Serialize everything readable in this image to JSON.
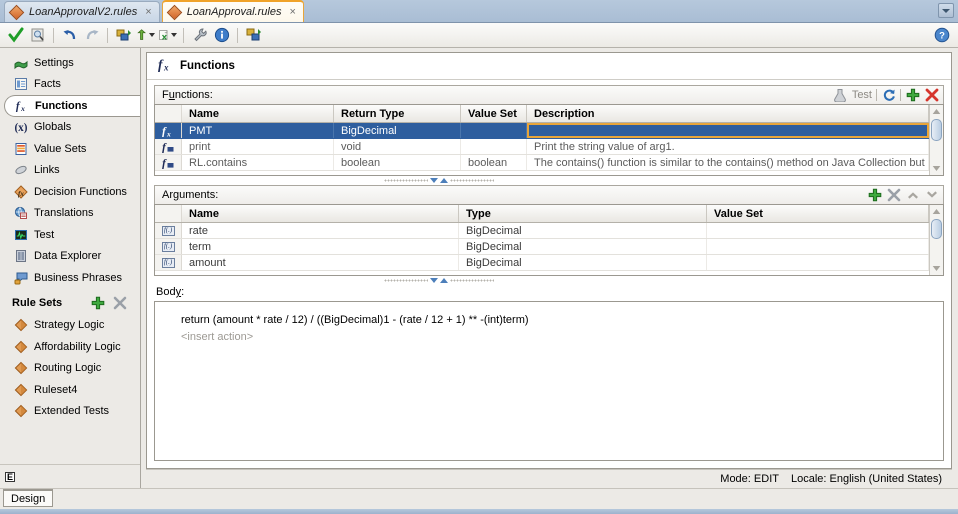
{
  "window": {
    "tabs": [
      {
        "label": "LoanApprovalV2.rules",
        "active": false,
        "close": "×",
        "icon": "diamond-icon"
      },
      {
        "label": "LoanApproval.rules",
        "active": true,
        "close": "×",
        "icon": "diamond-icon"
      }
    ],
    "tab_overflow_icon": "chevron-down-icon"
  },
  "toolbar": {
    "items": [
      {
        "name": "validate-icon",
        "title": "Validate"
      },
      {
        "name": "search-document-icon",
        "title": "Find"
      },
      {
        "name": "undo-icon",
        "title": "Undo"
      },
      {
        "name": "redo-icon",
        "title": "Redo"
      },
      {
        "name": "apply-icon",
        "title": "Apply"
      },
      {
        "name": "promote-icon",
        "title": "Promote",
        "dropdown": true
      },
      {
        "name": "export-excel-icon",
        "title": "Export",
        "dropdown": true
      },
      {
        "name": "wrench-icon",
        "title": "Tools"
      },
      {
        "name": "info-icon",
        "title": "Info"
      },
      {
        "name": "refactor-icon",
        "title": "Refactor"
      }
    ],
    "help_icon": "help-icon"
  },
  "sidebar": {
    "items": [
      {
        "label": "Settings",
        "icon": "settings-icon",
        "selected": false
      },
      {
        "label": "Facts",
        "icon": "facts-icon",
        "selected": false
      },
      {
        "label": "Functions",
        "icon": "function-fx-icon",
        "selected": true
      },
      {
        "label": "Globals",
        "icon": "globals-x-icon",
        "selected": false
      },
      {
        "label": "Value Sets",
        "icon": "value-sets-icon",
        "selected": false
      },
      {
        "label": "Links",
        "icon": "links-icon",
        "selected": false
      },
      {
        "label": "Decision Functions",
        "icon": "decision-functions-icon",
        "selected": false
      },
      {
        "label": "Translations",
        "icon": "translations-icon",
        "selected": false
      },
      {
        "label": "Test",
        "icon": "test-icon",
        "selected": false
      },
      {
        "label": "Data Explorer",
        "icon": "data-explorer-icon",
        "selected": false
      },
      {
        "label": "Business Phrases",
        "icon": "business-phrases-icon",
        "selected": false
      }
    ],
    "rule_sets": {
      "title": "Rule Sets",
      "add_icon": "plus-icon",
      "delete_icon": "x-icon",
      "items": [
        {
          "label": "Strategy Logic",
          "icon": "ruleset-icon"
        },
        {
          "label": "Affordability Logic",
          "icon": "ruleset-icon"
        },
        {
          "label": "Routing Logic",
          "icon": "ruleset-icon"
        },
        {
          "label": "Ruleset4",
          "icon": "ruleset-icon"
        },
        {
          "label": "Extended Tests",
          "icon": "ruleset-icon"
        }
      ]
    },
    "footer_glyph": "E"
  },
  "panel": {
    "title": "Functions",
    "title_icon": "function-fx-icon"
  },
  "functions_section": {
    "label": "Functions:",
    "label_accel": "u",
    "test_label": "Test",
    "test_icon": "test-tube-icon",
    "refresh_icon": "refresh-icon",
    "add_icon": "plus-icon",
    "delete_icon": "x-icon",
    "columns": [
      "",
      "Name",
      "Return Type",
      "Value Set",
      "Description"
    ],
    "rows": [
      {
        "icon": "function-fx-icon",
        "name": "PMT",
        "return_type": "BigDecimal",
        "value_set": "",
        "description": "",
        "selected": true,
        "focused_cell": "description"
      },
      {
        "icon": "function-lib-icon",
        "name": "print",
        "return_type": "void",
        "value_set": "",
        "description": "Print the string value of arg1.",
        "selected": false
      },
      {
        "icon": "function-lib-icon",
        "name": "RL.contains",
        "return_type": "boolean",
        "value_set": "boolean",
        "description": "The contains() function is similar to the contains() method on Java Collection but includes ...",
        "selected": false
      }
    ]
  },
  "arguments_section": {
    "label": "Arguments:",
    "label_accel": "g",
    "add_icon": "plus-icon",
    "delete_icon": "x-icon",
    "move_up_icon": "chevron-up-icon",
    "move_down_icon": "chevron-down-icon",
    "columns": [
      "",
      "Name",
      "Type",
      "Value Set"
    ],
    "rows": [
      {
        "icon": "argument-icon",
        "name": "rate",
        "type": "BigDecimal",
        "value_set": ""
      },
      {
        "icon": "argument-icon",
        "name": "term",
        "type": "BigDecimal",
        "value_set": ""
      },
      {
        "icon": "argument-icon",
        "name": "amount",
        "type": "BigDecimal",
        "value_set": ""
      }
    ]
  },
  "body_section": {
    "label": "Body:",
    "label_accel": "y",
    "lines": [
      {
        "text": "return (amount * rate / 12) / ((BigDecimal)1 - (rate / 12 + 1) ** -(int)term)",
        "ghost": false
      },
      {
        "text": "<insert action>",
        "ghost": true
      }
    ]
  },
  "statusbar": {
    "mode": "Mode: EDIT",
    "locale": "Locale: English (United States)"
  },
  "bottombar": {
    "tab": "Design"
  },
  "colors": {
    "selection_blue": "#2e5e9e",
    "focus_orange": "#e8a53a",
    "titlebar_blue": "#b6c8dc",
    "panel_bg": "#eceae6"
  }
}
